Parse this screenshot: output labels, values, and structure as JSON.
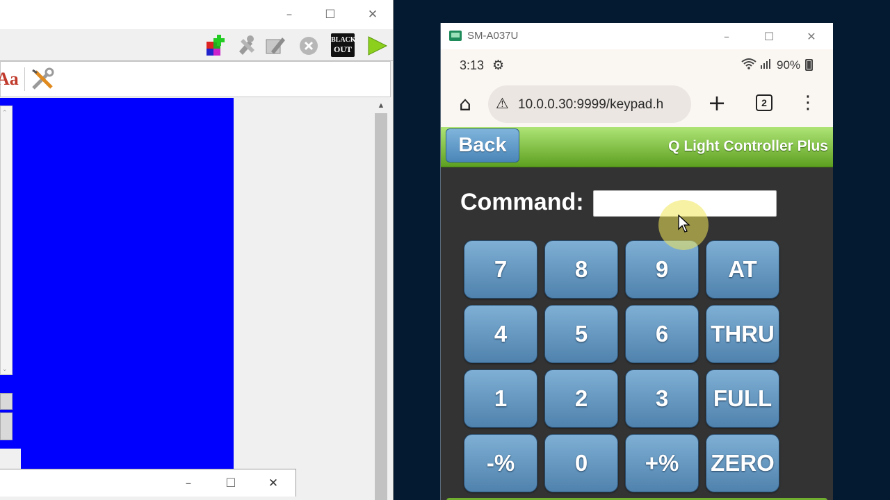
{
  "left_window": {
    "controls": {
      "minimize": "–",
      "maximize": "☐",
      "close": "✕"
    },
    "toolbar_icons": [
      "add-fixture-icon",
      "tools-icon",
      "edit-icon",
      "stop-icon",
      "blackout-icon",
      "play-icon"
    ],
    "blackout_label_1": "BLACK",
    "blackout_label_2": "OUT",
    "subtoolbar_icons": [
      "font-icon",
      "wrench-screwdriver-icon"
    ],
    "subtoolbar_font_glyph": "Aa",
    "panel_color": "#0000ff",
    "dialog_controls": {
      "minimize": "–",
      "maximize": "☐",
      "close": "✕"
    }
  },
  "phone_window": {
    "title": "SM-A037U",
    "controls": {
      "minimize": "–",
      "maximize": "☐",
      "close": "✕"
    },
    "status": {
      "time": "3:13",
      "battery": "90%"
    },
    "browser": {
      "url": "10.0.0.30:9999/keypad.h",
      "tab_count": "2"
    },
    "header": {
      "back_label": "Back",
      "app_title": "Q Light Controller Plus"
    },
    "keypad": {
      "command_label": "Command:",
      "command_value": "",
      "rows": [
        [
          "7",
          "8",
          "9",
          "AT"
        ],
        [
          "4",
          "5",
          "6",
          "THRU"
        ],
        [
          "1",
          "2",
          "3",
          "FULL"
        ],
        [
          "-%",
          "0",
          "+%",
          "ZERO"
        ]
      ]
    },
    "colors": {
      "header_green": "#5da020",
      "key_blue": "#5f90bb",
      "background": "#333333"
    }
  }
}
